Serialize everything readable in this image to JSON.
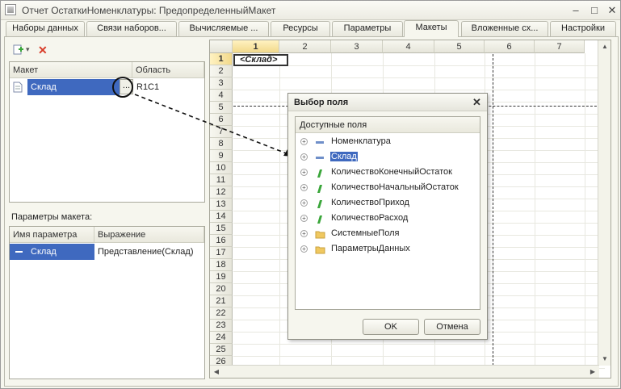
{
  "window": {
    "title": "Отчет ОстаткиНоменклатуры: ПредопределенныйМакет",
    "min_label": "–",
    "max_label": "□",
    "close_label": "✕"
  },
  "tabs": [
    {
      "label": "Наборы данных"
    },
    {
      "label": "Связи наборов..."
    },
    {
      "label": "Вычисляемые ..."
    },
    {
      "label": "Ресурсы"
    },
    {
      "label": "Параметры"
    },
    {
      "label": "Макеты"
    },
    {
      "label": "Вложенные сх..."
    },
    {
      "label": "Настройки"
    }
  ],
  "toolbar": {
    "add_icon": "add-icon",
    "add_dropdown": "▾",
    "delete_label": "✕"
  },
  "layouts_table": {
    "headers": [
      "Макет",
      "Область"
    ],
    "rows": [
      {
        "name": "Склад",
        "area": "R1C1",
        "select_button": "..."
      }
    ]
  },
  "params": {
    "label": "Параметры макета:",
    "headers": [
      "Имя параметра",
      "Выражение"
    ],
    "rows": [
      {
        "name": "Склад",
        "expression": "Представление(Склад)"
      }
    ]
  },
  "sheet": {
    "columns": [
      "1",
      "2",
      "3",
      "4",
      "5",
      "6",
      "7"
    ],
    "rows": [
      "1",
      "2",
      "3",
      "4",
      "5",
      "6",
      "7",
      "8",
      "9",
      "10",
      "11",
      "12",
      "13",
      "14",
      "15",
      "16",
      "17",
      "18",
      "19",
      "20",
      "21",
      "22",
      "23",
      "24",
      "25",
      "26"
    ],
    "cell_r1c1": "<Склад>"
  },
  "dialog": {
    "title": "Выбор поля",
    "close_label": "✕",
    "fields_header": "Доступные поля",
    "fields": [
      {
        "label": "Номенклатура",
        "icon": "dimension"
      },
      {
        "label": "Склад",
        "icon": "dimension"
      },
      {
        "label": "КоличествоКонечныйОстаток",
        "icon": "resource"
      },
      {
        "label": "КоличествоНачальныйОстаток",
        "icon": "resource"
      },
      {
        "label": "КоличествоПриход",
        "icon": "resource"
      },
      {
        "label": "КоличествоРасход",
        "icon": "resource"
      },
      {
        "label": "СистемныеПоля",
        "icon": "folder"
      },
      {
        "label": "ПараметрыДанных",
        "icon": "folder"
      }
    ],
    "ok_label": "OK",
    "cancel_label": "Отмена"
  },
  "colors": {
    "selection": "#3f69bf",
    "resource_icon": "#3aa63a",
    "dimension_icon": "#6f8fc9",
    "folder_icon": "#f0c860"
  }
}
